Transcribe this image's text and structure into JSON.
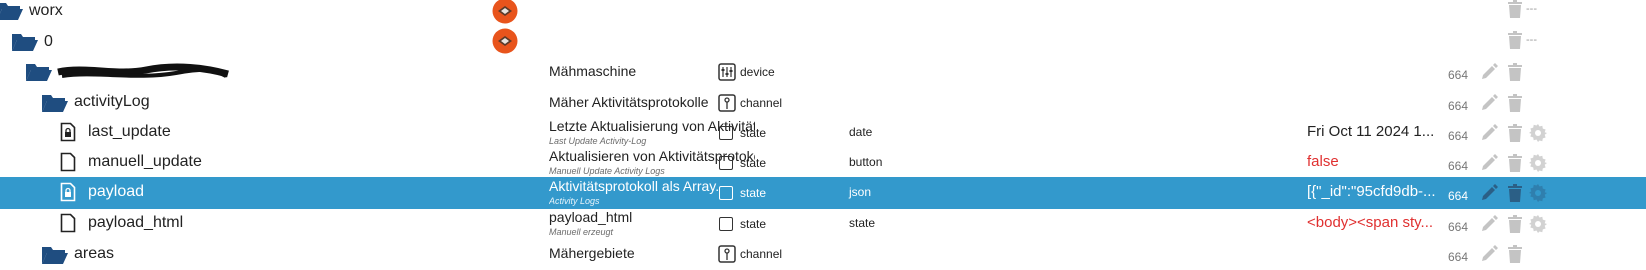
{
  "tree": {
    "rows": [
      {
        "name": "worx",
        "dashes": "---"
      },
      {
        "name": "0",
        "dashes": "---"
      },
      {
        "name_redacted": true,
        "description": "Mähmaschine",
        "type": "device",
        "acl": "664"
      },
      {
        "name": "activityLog",
        "description": "Mäher Aktivitätsprotokolle",
        "type": "channel",
        "acl": "664"
      },
      {
        "name": "last_update",
        "description": "Letzte Aktualisierung von Aktivitätsprotokoll",
        "sub": "Last Update Activity-Log",
        "type": "state",
        "role": "date",
        "value": "Fri Oct 11 2024 1...",
        "acl": "664"
      },
      {
        "name": "manuell_update",
        "description": "Aktualisieren von Aktivitätsprotokoll",
        "sub": "Manuell Update Activity Logs",
        "type": "state",
        "role": "button",
        "value": "false",
        "acl": "664"
      },
      {
        "name": "payload",
        "description": "Aktivitätsprotokoll als Array.",
        "sub": "Activity Logs",
        "type": "state",
        "role": "json",
        "value": "[{\"_id\":\"95cfd9db-...",
        "acl": "664"
      },
      {
        "name": "payload_html",
        "description": "payload_html",
        "sub": "Manuell erzeugt",
        "type": "state",
        "role": "state",
        "value": "<body><span sty...",
        "acl": "664"
      },
      {
        "name": "areas",
        "description": "Mähergebiete",
        "type": "channel",
        "acl": "664"
      }
    ]
  },
  "colors": {
    "selected_row": "#3399cc",
    "folder": "#1f4d80",
    "adapter_badge": "#e8541c",
    "value_red": "#e03030"
  },
  "icons": {
    "folder": "folder-open-icon",
    "file": "file-icon",
    "locked_file": "file-lock-icon",
    "adapter": "worx-adapter-icon",
    "device": "device-icon",
    "channel": "channel-icon",
    "state": "state-icon",
    "edit": "pencil-icon",
    "delete": "trash-icon",
    "settings": "gear-icon"
  }
}
